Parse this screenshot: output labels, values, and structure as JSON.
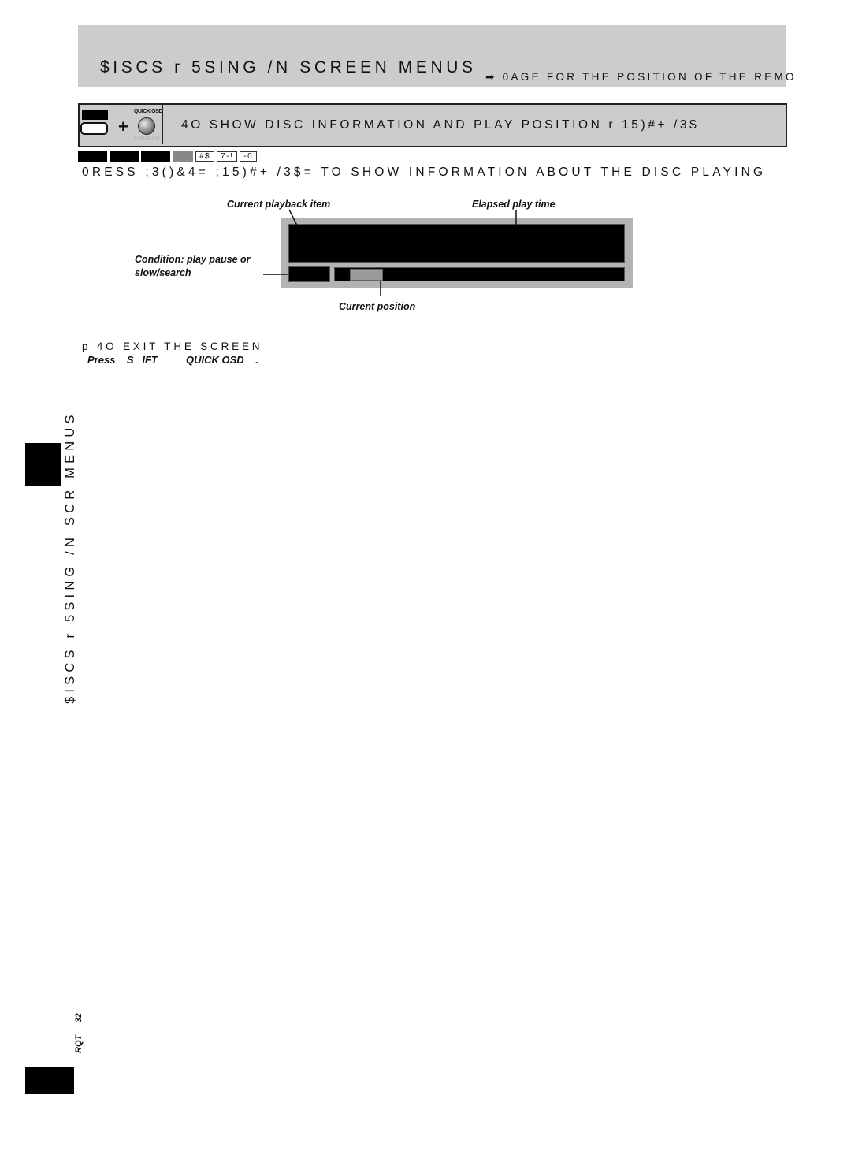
{
  "header": {
    "title": "$ISCS r 5SING /N SCREEN MENUS",
    "reference": "➡ 0AGE     FOR THE POSITION OF THE REMO"
  },
  "section": {
    "icon_quick_label": "QUICK OSD",
    "icon_functions_label": "FUNCTIONS",
    "title": "4O SHOW DISC INFORMATION AND PLAY POSITION r  15)#+ /3$"
  },
  "disc_tags": {
    "labels": [
      "#$",
      "7-!",
      "-0"
    ]
  },
  "instruction": "0RESS ;3()&4=  ;15)#+ /3$= TO SHOW INFORMATION ABOUT THE DISC PLAYING",
  "diagram": {
    "callouts": {
      "current_item": "Current playback item",
      "elapsed_time": "Elapsed play time",
      "condition_line1": "Condition: play    pause or",
      "condition_line2": "slow/search",
      "current_position": "Current position"
    },
    "position_fraction": 0.05
  },
  "exit": {
    "title": "p 4O EXIT THE SCREEN",
    "step": "Press    S   IFT          QUICK OSD    ."
  },
  "side_label": "$ISCS r 5SING /N SCR    MENUS",
  "footer": {
    "page_code": "RQT     32"
  }
}
